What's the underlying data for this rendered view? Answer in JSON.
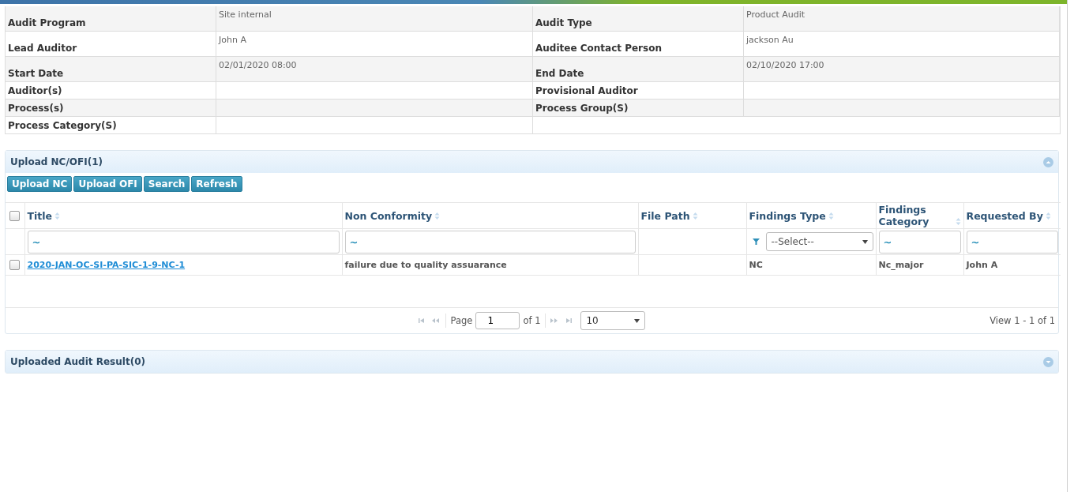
{
  "details": {
    "rows": [
      {
        "fields": [
          {
            "label": "Audit Program",
            "value": "Site internal"
          },
          {
            "label": "Audit Type",
            "value": "Product Audit"
          }
        ]
      },
      {
        "fields": [
          {
            "label": "Lead Auditor",
            "value": "John A"
          },
          {
            "label": "Auditee Contact Person",
            "value": "jackson Au"
          }
        ]
      },
      {
        "fields": [
          {
            "label": "Start Date",
            "value": "02/01/2020 08:00"
          },
          {
            "label": "End Date",
            "value": "02/10/2020 17:00"
          }
        ]
      },
      {
        "fields": [
          {
            "label": "Auditor(s)"
          },
          {
            "label": "Provisional Auditor"
          }
        ]
      },
      {
        "fields": [
          {
            "label": "Process(s)"
          },
          {
            "label": "Process Group(S)"
          }
        ]
      },
      {
        "fields": [
          {
            "label": "Process Category(S)"
          }
        ]
      }
    ]
  },
  "panels": [
    {
      "title": "Upload NC/OFI(1)",
      "expanded": true,
      "buttons": [
        "Upload NC",
        "Upload OFI",
        "Search",
        "Refresh"
      ],
      "grid": {
        "select_all_checked": false,
        "columns": [
          {
            "label": "Title",
            "filter": {
              "kind": "text",
              "value": "~"
            }
          },
          {
            "label": "Non Conformity",
            "filter": {
              "kind": "text",
              "value": "~"
            }
          },
          {
            "label": "File Path",
            "filter": {
              "kind": "none"
            }
          },
          {
            "label": "Findings Type",
            "filter": {
              "kind": "select",
              "value": "--Select--"
            }
          },
          {
            "label": "Findings Category",
            "filter": {
              "kind": "text",
              "value": "~"
            }
          },
          {
            "label": "Requested By",
            "filter": {
              "kind": "text",
              "value": "~"
            }
          }
        ],
        "rows": [
          {
            "checked": false,
            "cells": [
              "2020-JAN-OC-SI-PA-SIC-1-9-NC-1 ",
              "failure due to quality assuarance",
              "",
              "NC",
              "Nc_major",
              "John A"
            ]
          }
        ],
        "pager": {
          "page_label": "Page",
          "page": "1",
          "of_label": "of 1",
          "page_size": "10",
          "summary": "View 1 - 1 of 1"
        }
      }
    },
    {
      "title": "Uploaded Audit Result(0)",
      "expanded": false
    }
  ]
}
